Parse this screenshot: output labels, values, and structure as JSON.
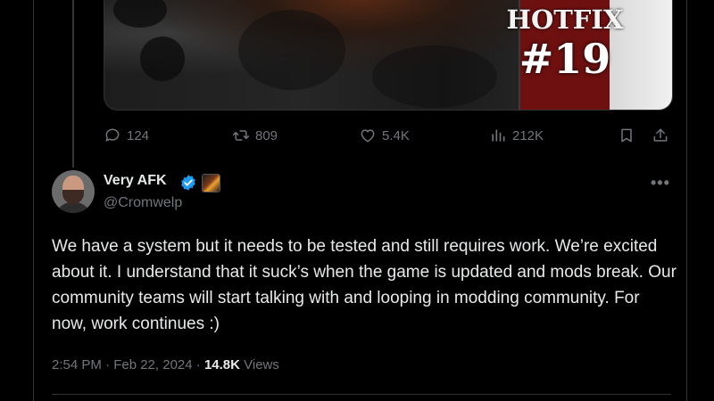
{
  "media": {
    "title": "HOTFIX",
    "number": "#19"
  },
  "actions": {
    "replies": "124",
    "reposts": "809",
    "likes": "5.4K",
    "views": "212K"
  },
  "reply_tweet": {
    "author_name": "Very AFK",
    "handle": "@Cromwelp",
    "text": "We have a system but it needs to be tested and still requires work. We’re excited about it. I understand that it suck’s when the game is updated and mods break. Our community teams will start talking with and looping in modding community. For now, work continues :)",
    "timestamp": "2:54 PM · Feb 22, 2024",
    "separator": " · ",
    "view_count": "14.8K",
    "views_label": " Views"
  },
  "icons": {
    "reply": "reply-icon",
    "repost": "repost-icon",
    "like": "like-icon",
    "views": "views-icon",
    "bookmark": "bookmark-icon",
    "share": "share-icon",
    "verified": "verified-badge-icon",
    "more": "more-icon"
  },
  "colors": {
    "background": "#000000",
    "text_primary": "#e7e9ea",
    "text_secondary": "#71767b",
    "verified_blue": "#1d9bf0",
    "border": "#2f3336"
  }
}
